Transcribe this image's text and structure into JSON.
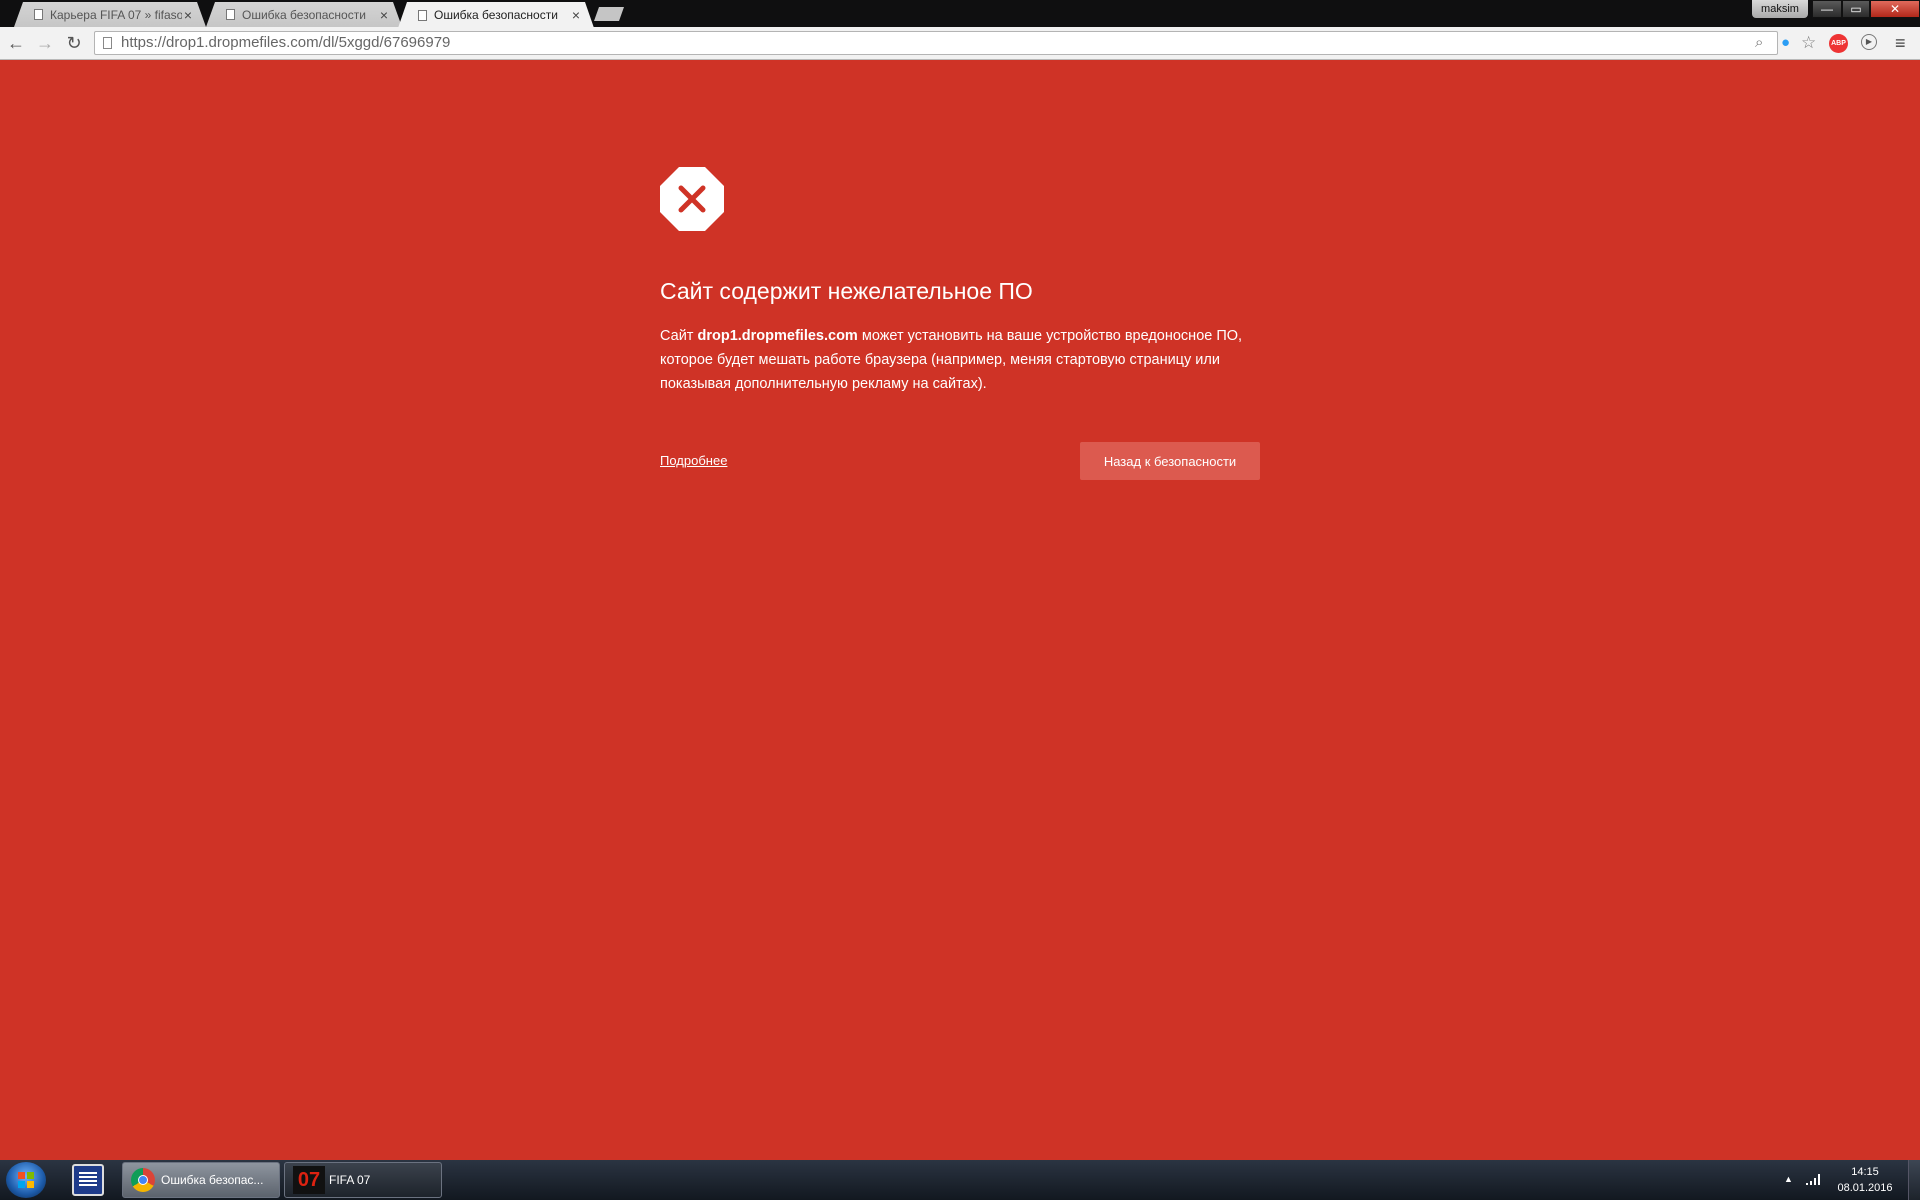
{
  "browser": {
    "tabs": [
      {
        "label": "Карьера FIFA 07 » fifasoc",
        "active": false
      },
      {
        "label": "Ошибка безопасности",
        "active": false
      },
      {
        "label": "Ошибка безопасности",
        "active": true
      }
    ],
    "user": "maksim",
    "url": "https://drop1.dropmefiles.com/dl/5xggd/67696979",
    "extensions": [
      "abp-icon",
      "play-icon"
    ],
    "abp_label": "ABP"
  },
  "page": {
    "heading": "Сайт содержит нежелательное ПО",
    "body_prefix": "Сайт",
    "body_domain": "drop1.dropmefiles.com",
    "body_suffix": "может установить на ваше устройство вредоносное ПО, которое будет мешать работе браузера (например, меняя стартовую страницу или показывая дополнительную рекламу на сайтах).",
    "details_link": "Подробнее",
    "back_button": "Назад к безопасности",
    "background_color": "#cf3326"
  },
  "taskbar": {
    "tasks": [
      {
        "label": "Ошибка безопас...",
        "icon": "chrome-icon"
      },
      {
        "label": "FIFA 07",
        "icon": "fifa07-icon",
        "icon_text": "07"
      }
    ],
    "clock": {
      "time": "14:15",
      "date": "08.01.2016"
    }
  }
}
